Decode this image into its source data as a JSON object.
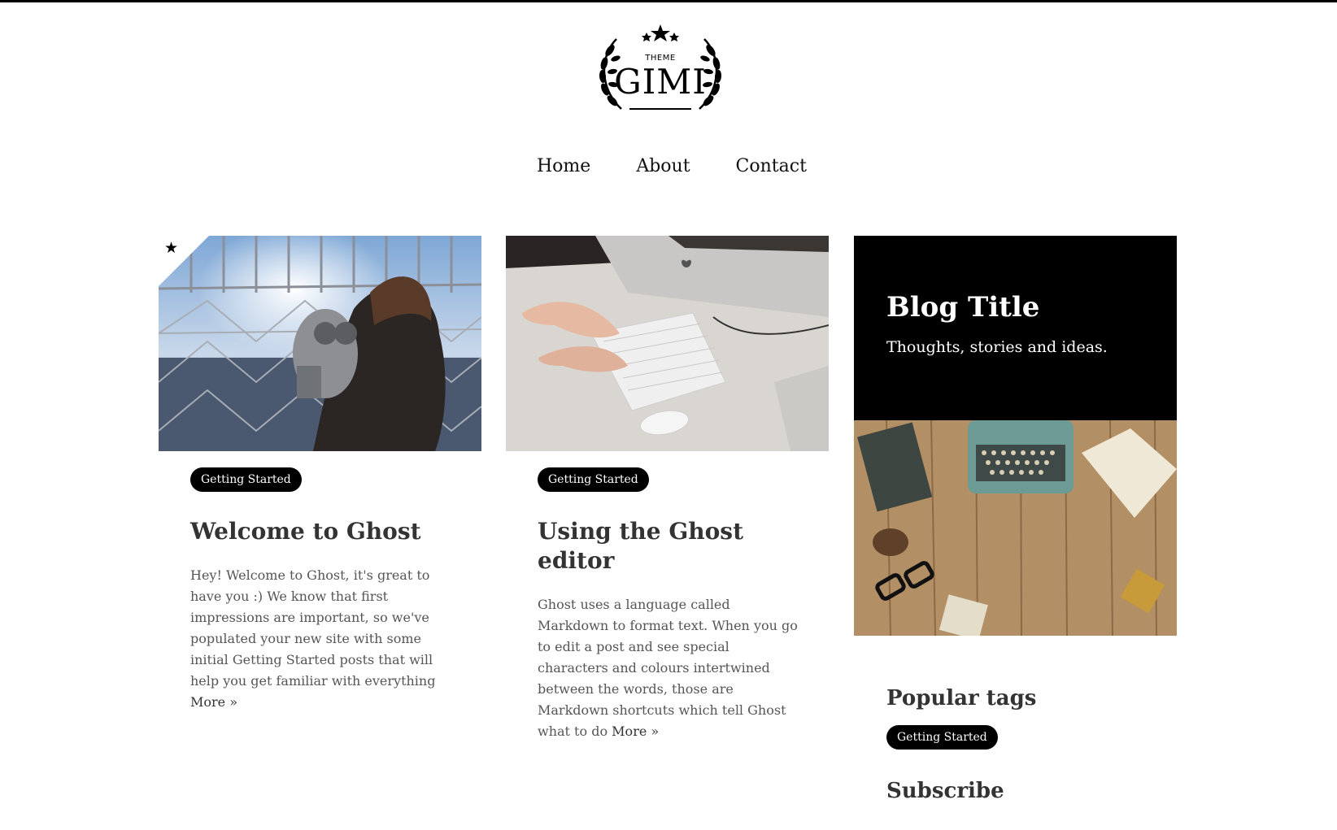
{
  "logo": {
    "theme": "THEME",
    "name": "GIMI"
  },
  "nav": [
    {
      "label": "Home"
    },
    {
      "label": "About"
    },
    {
      "label": "Contact"
    }
  ],
  "posts": [
    {
      "featured": true,
      "tag": "Getting Started",
      "title": "Welcome to Ghost",
      "excerpt": "Hey! Welcome to Ghost, it's great to have you :) We know that first impressions are important, so we've populated your new site with some initial Getting Started posts that will help you get familiar with everything",
      "more": "More »"
    },
    {
      "featured": false,
      "tag": "Getting Started",
      "title": "Using the Ghost editor",
      "excerpt": "Ghost uses a language called Markdown to format text. When you go to edit a post and see special characters and colours intertwined between the words, those are Markdown shortcuts which tell Ghost what to do",
      "more": "More »"
    }
  ],
  "sidebar": {
    "blog_title": "Blog Title",
    "blog_description": "Thoughts, stories and ideas.",
    "popular_tags_heading": "Popular tags",
    "popular_tags": [
      "Getting Started"
    ],
    "subscribe_heading": "Subscribe"
  },
  "icons": {
    "featured": "star-icon",
    "logo_wreath": "laurel-wreath-icon"
  }
}
